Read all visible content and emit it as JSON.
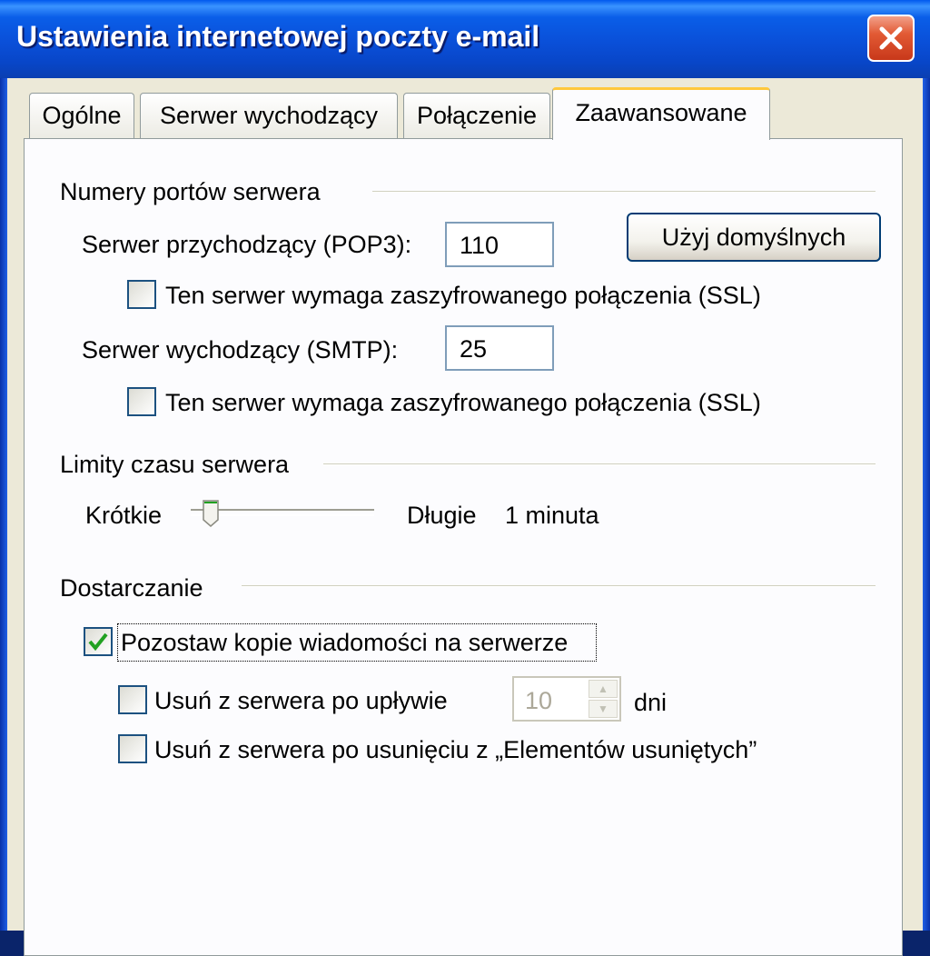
{
  "window": {
    "title": "Ustawienia internetowej poczty e-mail"
  },
  "tabs": [
    {
      "label": "Ogólne",
      "active": false
    },
    {
      "label": "Serwer wychodzący",
      "active": false
    },
    {
      "label": "Połączenie",
      "active": false
    },
    {
      "label": "Zaawansowane",
      "active": true
    }
  ],
  "ports": {
    "section_title": "Numery portów serwera",
    "incoming_label": "Serwer przychodzący (POP3):",
    "incoming_value": "110",
    "incoming_ssl_label": "Ten serwer wymaga zaszyfrowanego połączenia (SSL)",
    "incoming_ssl_checked": false,
    "outgoing_label": "Serwer wychodzący (SMTP):",
    "outgoing_value": "25",
    "outgoing_ssl_label": "Ten serwer wymaga zaszyfrowanego połączenia (SSL)",
    "outgoing_ssl_checked": false,
    "defaults_button": "Użyj domyślnych"
  },
  "timeouts": {
    "section_title": "Limity czasu serwera",
    "short_label": "Krótkie",
    "long_label": "Długie",
    "value_label": "1 minuta",
    "slider_fraction": 0.1
  },
  "delivery": {
    "section_title": "Dostarczanie",
    "leave_copy_label": "Pozostaw kopie wiadomości na serwerze",
    "leave_copy_checked": true,
    "remove_after_label": "Usuń z serwera po upływie",
    "remove_after_checked": false,
    "remove_after_days": "10",
    "days_label": "dni",
    "remove_deleted_label": "Usuń z serwera po usunięciu z „Elementów usuniętych”",
    "remove_deleted_checked": false
  },
  "colors": {
    "title_bar": "#0a4fd8",
    "close_button": "#e25a34",
    "active_tab_accent": "#ffc83c",
    "check_mark": "#21a121"
  }
}
